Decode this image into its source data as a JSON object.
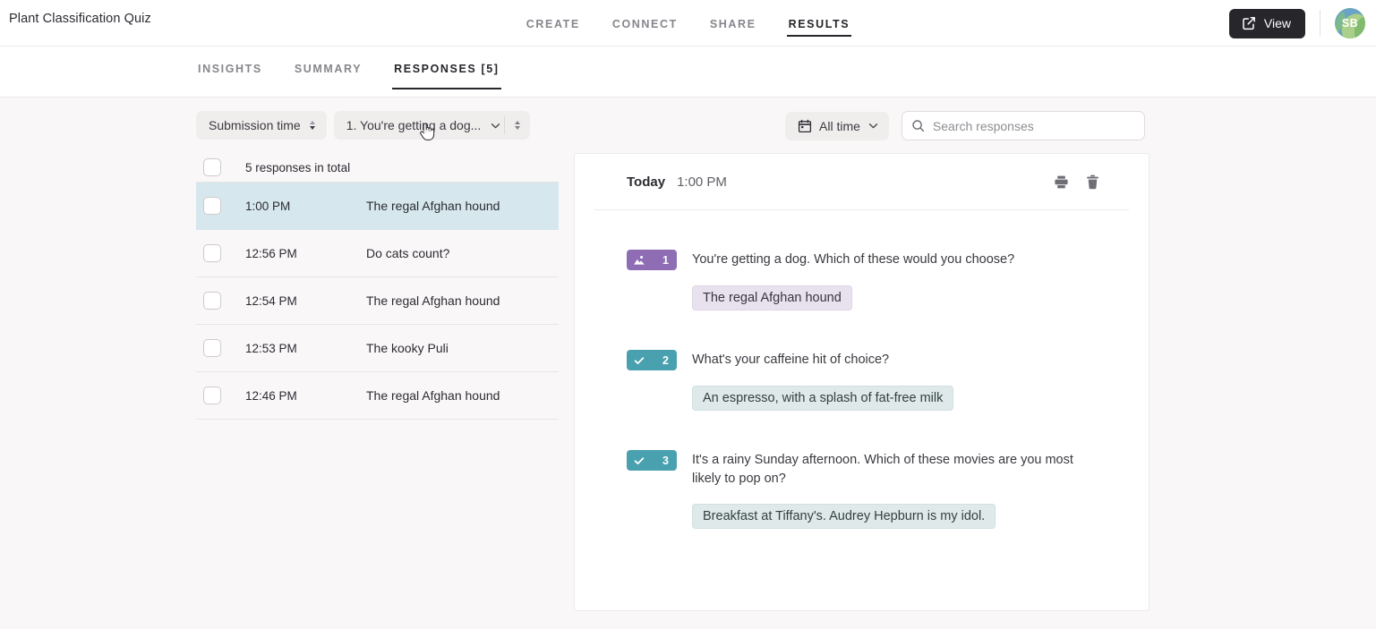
{
  "header": {
    "form_title": "Plant Classification Quiz",
    "nav": [
      {
        "label": "CREATE",
        "active": false
      },
      {
        "label": "CONNECT",
        "active": false
      },
      {
        "label": "SHARE",
        "active": false
      },
      {
        "label": "RESULTS",
        "active": true
      }
    ],
    "view_button": "View",
    "view_icon": "external-link-icon",
    "avatar_initials": "SB"
  },
  "subtabs": [
    {
      "label": "INSIGHTS",
      "active": false
    },
    {
      "label": "SUMMARY",
      "active": false
    },
    {
      "label": "RESPONSES [5]",
      "active": true
    }
  ],
  "toolbar": {
    "sort_by": "Submission time",
    "sort_icon": "sort-arrows-icon",
    "question_filter": "1. You're getting a dog...",
    "question_chevron_icon": "chevron-down-icon",
    "question_sort_icon": "sort-arrows-icon",
    "date_filter": "All time",
    "date_icon": "calendar-icon",
    "date_chevron_icon": "chevron-down-icon",
    "search_placeholder": "Search responses",
    "search_value": "",
    "search_icon": "search-icon"
  },
  "list": {
    "total_label": "5 responses in total",
    "rows": [
      {
        "time": "1:00 PM",
        "answer": "The regal Afghan hound",
        "selected": true
      },
      {
        "time": "12:56 PM",
        "answer": "Do cats count?",
        "selected": false
      },
      {
        "time": "12:54 PM",
        "answer": "The regal Afghan hound",
        "selected": false
      },
      {
        "time": "12:53 PM",
        "answer": "The kooky Puli",
        "selected": false
      },
      {
        "time": "12:46 PM",
        "answer": "The regal Afghan hound",
        "selected": false
      }
    ]
  },
  "detail": {
    "day_label": "Today",
    "time_label": "1:00 PM",
    "print_icon": "printer-icon",
    "delete_icon": "trash-icon",
    "questions": [
      {
        "number": "1",
        "badge_icon": "image-icon",
        "badge_color": "#8f6db5",
        "answer_style": "purple",
        "text": "You're getting a dog. Which of these would you choose?",
        "answer": "The regal Afghan hound"
      },
      {
        "number": "2",
        "badge_icon": "check-icon",
        "badge_color": "#49a0ae",
        "answer_style": "teal",
        "text": "What's your caffeine hit of choice?",
        "answer": "An espresso, with a splash of fat-free milk"
      },
      {
        "number": "3",
        "badge_icon": "check-icon",
        "badge_color": "#49a0ae",
        "answer_style": "teal",
        "text": "It's a rainy Sunday afternoon. Which of these movies are you most likely to pop on?",
        "answer": "Breakfast at Tiffany's. Audrey Hepburn is my idol."
      }
    ]
  },
  "colors": {
    "page_bg": "#faf7f8",
    "accent_dark": "#26262b",
    "selected_row": "#d6e8ee",
    "purple_badge": "#8f6db5",
    "teal_badge": "#49a0ae"
  }
}
